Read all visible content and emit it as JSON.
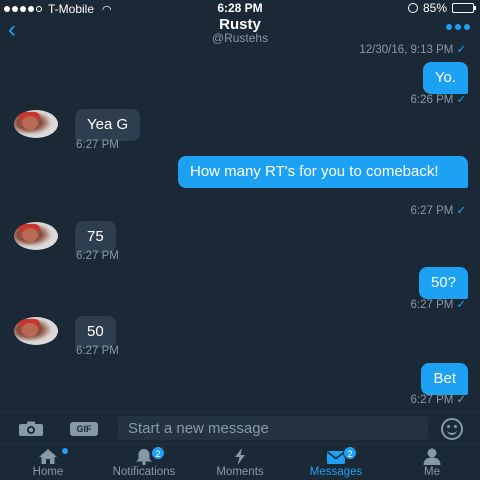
{
  "status_bar": {
    "carrier": "T-Mobile",
    "time": "6:28 PM",
    "battery": "85%",
    "battery_level": 0.85
  },
  "header": {
    "title": "Rusty",
    "handle": "@Rustehs"
  },
  "messages": [
    {
      "timestamp": "12/30/16, 9:13 PM"
    },
    {
      "text": "Yo.",
      "timestamp": "6:26 PM"
    },
    {
      "text": "Yea G",
      "timestamp": "6:27 PM"
    },
    {
      "text": "How many RT's for you to comeback!",
      "timestamp": "6:27 PM"
    },
    {
      "text": "75",
      "timestamp": "6:27 PM"
    },
    {
      "text": "50?",
      "timestamp": "6:27 PM"
    },
    {
      "text": "50",
      "timestamp": "6:27 PM"
    },
    {
      "text": "Bet",
      "timestamp": "6:27 PM"
    }
  ],
  "composer": {
    "gif_label": "GIF",
    "placeholder": "Start a new message"
  },
  "tabs": [
    {
      "label": "Home",
      "icon": "home-icon"
    },
    {
      "label": "Notifications",
      "icon": "bell-icon",
      "badge": "2"
    },
    {
      "label": "Moments",
      "icon": "lightning-icon"
    },
    {
      "label": "Messages",
      "icon": "envelope-icon",
      "badge": "2"
    },
    {
      "label": "Me",
      "icon": "person-icon"
    }
  ],
  "colors": {
    "accent": "#1da1f2",
    "background": "#1b2836",
    "incoming_bubble": "#2f3e4e",
    "muted": "#8899a6"
  }
}
